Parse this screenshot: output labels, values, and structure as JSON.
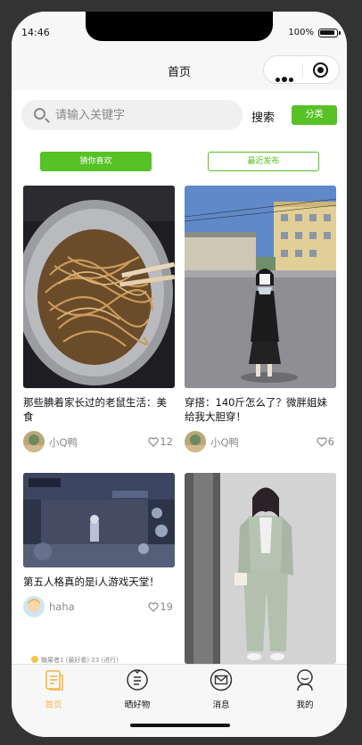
{
  "status": {
    "time": "14:46",
    "battery": "100%"
  },
  "nav": {
    "title": "首页"
  },
  "search": {
    "placeholder": "请输入关键字",
    "button": "搜索",
    "category": "分类"
  },
  "tabs": {
    "active": "猜你喜欢",
    "inactive": "最近发布"
  },
  "cards": [
    {
      "title": "那些腆着家长过的老鼠生活：美食",
      "author": "小Q鸭",
      "likes": "12"
    },
    {
      "title": "穿搭：140斤怎么了？微胖姐妹给我大胆穿！",
      "author": "小Q鸭",
      "likes": "6"
    },
    {
      "title": "第五人格真的是i人游戏天堂！",
      "author": "haha",
      "likes": "19"
    },
    {
      "title": "",
      "author": "",
      "likes": ""
    }
  ],
  "peek": {
    "text": "糖果者1 (最好看) 23 (进行)"
  },
  "tabbar": [
    {
      "label": "首页",
      "icon": "home-icon"
    },
    {
      "label": "晒好物",
      "icon": "list-icon"
    },
    {
      "label": "消息",
      "icon": "mail-icon"
    },
    {
      "label": "我的",
      "icon": "user-icon"
    }
  ],
  "colors": {
    "accent": "#56c225",
    "tabActive": "#f3b745"
  }
}
